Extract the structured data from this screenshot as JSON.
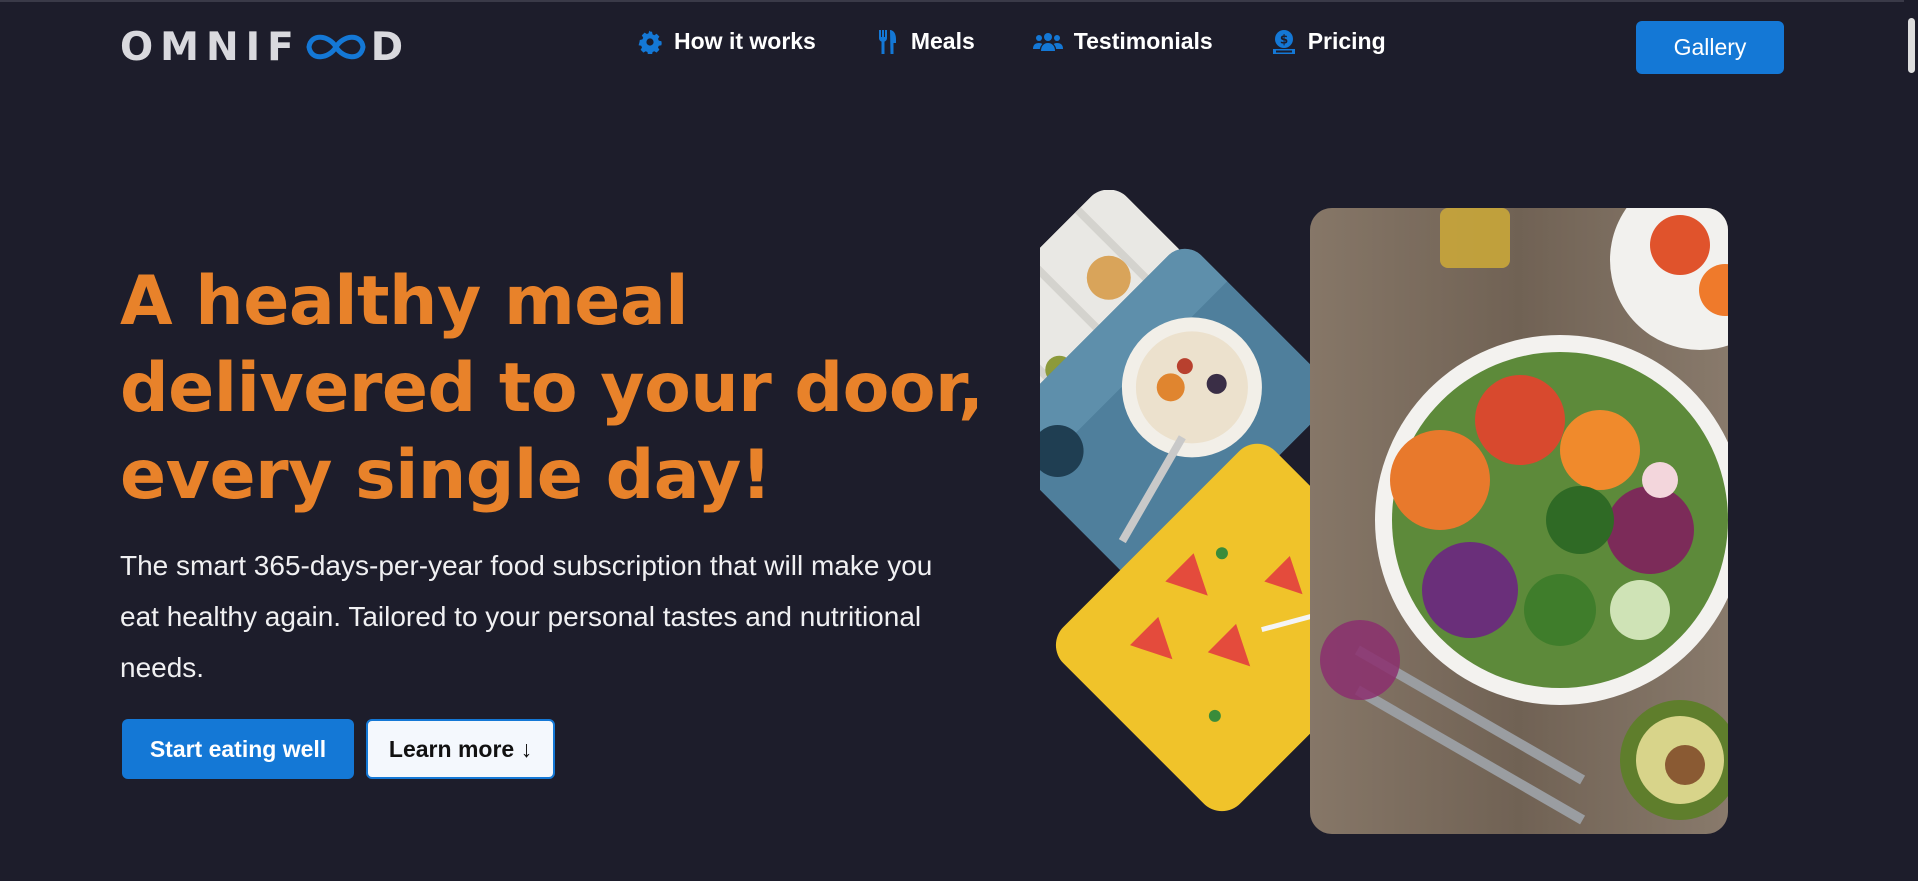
{
  "brand": {
    "logo_left": "OMNIF",
    "logo_right": "D"
  },
  "nav": {
    "items": [
      {
        "label": "How it works",
        "icon": "gear-icon"
      },
      {
        "label": "Meals",
        "icon": "fork-knife-icon"
      },
      {
        "label": "Testimonials",
        "icon": "users-icon"
      },
      {
        "label": "Pricing",
        "icon": "money-icon"
      }
    ],
    "gallery_label": "Gallery"
  },
  "hero": {
    "title": "A healthy meal delivered to your door, every single day!",
    "description": "The smart 365-days-per-year food subscription that will make you eat healthy again. Tailored to your personal tastes and nutritional needs.",
    "primary_cta": "Start eating well",
    "secondary_cta": "Learn more ↓"
  },
  "colors": {
    "background": "#1d1d2b",
    "accent": "#1478d6",
    "heading": "#e8822a"
  }
}
